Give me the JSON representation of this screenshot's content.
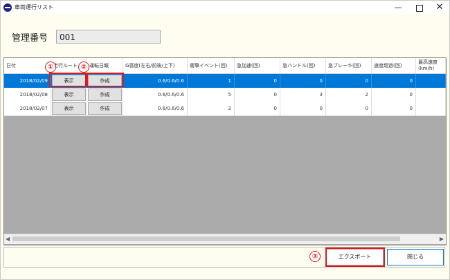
{
  "window": {
    "title": "車両運行リスト",
    "controls": {
      "minimize": "—",
      "maximize": "□",
      "close": "✕"
    }
  },
  "management": {
    "label": "管理番号",
    "value": "001"
  },
  "table": {
    "headers": {
      "date": "日付",
      "route": "走行ルート",
      "daily_report": "運転日報",
      "g_sensitivity": "G感度(左右/前後/上下)",
      "impact_event": "衝撃イベント(回)",
      "sudden_accel": "急加速(回)",
      "sudden_steer": "急ハンドル(回)",
      "sudden_brake": "急ブレーキ(回)",
      "overspeed": "速度超過(回)",
      "max_speed": "最高速度(km/h)"
    },
    "rows": [
      {
        "date": "2018/02/09",
        "route_btn": "表示",
        "report_btn": "作成",
        "g": "0.6/0.6/0.6",
        "impact": "1",
        "accel": "0",
        "steer": "0",
        "brake": "0",
        "overspeed": "0",
        "max_speed": "",
        "selected": true
      },
      {
        "date": "2018/02/08",
        "route_btn": "表示",
        "report_btn": "作成",
        "g": "0.6/0.6/0.6",
        "impact": "5",
        "accel": "0",
        "steer": "3",
        "brake": "2",
        "overspeed": "0",
        "max_speed": "",
        "selected": false
      },
      {
        "date": "2018/02/07",
        "route_btn": "表示",
        "report_btn": "作成",
        "g": "0.6/0.6/0.6",
        "impact": "2",
        "accel": "0",
        "steer": "0",
        "brake": "0",
        "overspeed": "0",
        "max_speed": "",
        "selected": false
      }
    ]
  },
  "scrollbar": {
    "left_arrow": "◀",
    "right_arrow": "▶"
  },
  "buttons": {
    "export": "エクスポート",
    "close": "閉じる"
  },
  "callouts": {
    "one": "①",
    "two": "②",
    "three": "③"
  },
  "colors": {
    "selection": "#0078d7",
    "highlight": "#e01818",
    "background": "#fffdf0"
  }
}
